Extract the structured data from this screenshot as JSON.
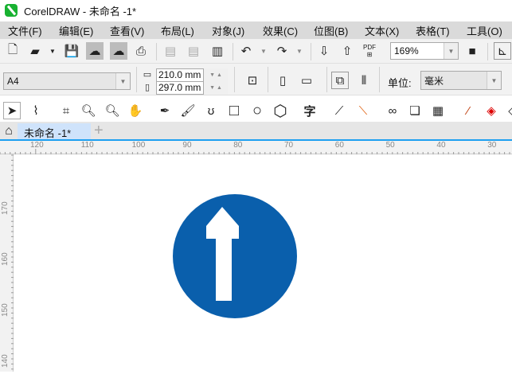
{
  "app": {
    "title": "CorelDRAW - 未命名 -1*"
  },
  "menu": [
    "文件(F)",
    "编辑(E)",
    "查看(V)",
    "布局(L)",
    "对象(J)",
    "效果(C)",
    "位图(B)",
    "文本(X)",
    "表格(T)",
    "工具(O)"
  ],
  "toolbar": {
    "zoom": "169%",
    "pdf_label": "PDF"
  },
  "property_bar": {
    "page_size": "A4",
    "width": "210.0 mm",
    "height": "297.0 mm",
    "unit_label": "单位:",
    "unit": "毫米"
  },
  "toolbox": {
    "text_tool": "字"
  },
  "tabs": {
    "document": "未命名 -1*",
    "add": "+"
  },
  "rulers": {
    "horizontal": [
      "120",
      "110",
      "100",
      "90",
      "80",
      "70",
      "60",
      "50",
      "40",
      "30"
    ],
    "vertical": [
      "170",
      "160",
      "150",
      "140"
    ]
  },
  "sign": {
    "circle_color": "#0a5fac",
    "arrow_color": "#ffffff"
  }
}
